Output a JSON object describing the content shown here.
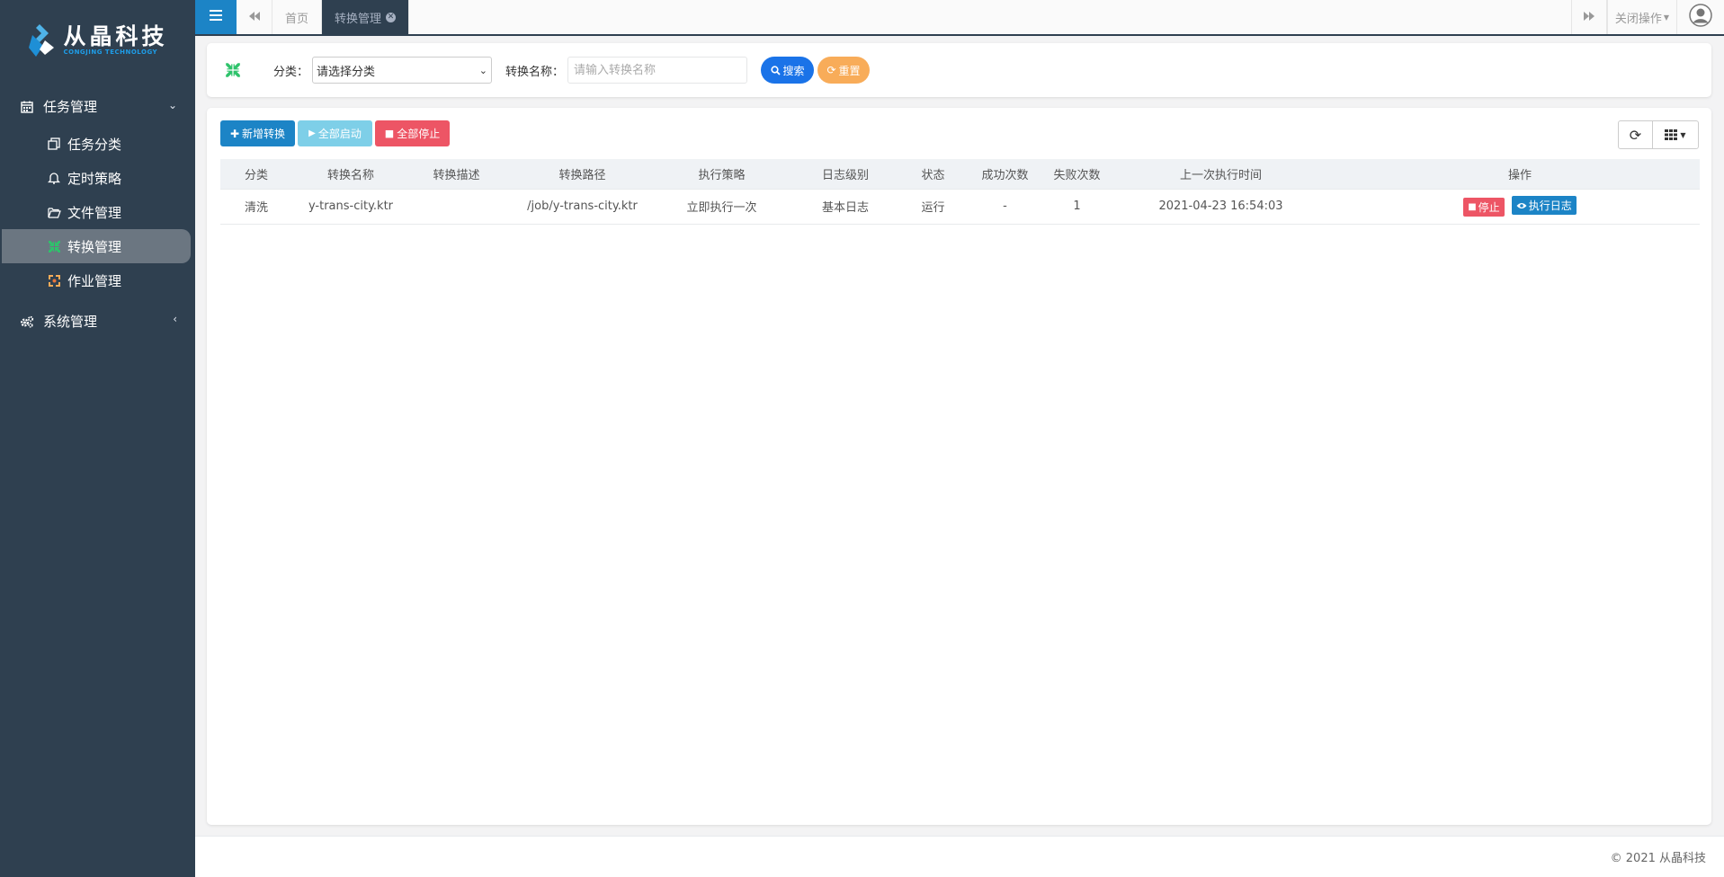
{
  "app": {
    "logo_cn": "从晶科技",
    "logo_en": "CONGJING TECHNOLOGY"
  },
  "sidebar": {
    "groups": [
      {
        "label": "任务管理",
        "icon": "calendar-icon",
        "expanded": true,
        "items": [
          {
            "label": "任务分类",
            "icon": "copy-icon"
          },
          {
            "label": "定时策略",
            "icon": "bell-icon"
          },
          {
            "label": "文件管理",
            "icon": "folder-open-icon"
          },
          {
            "label": "转换管理",
            "icon": "compress-icon",
            "active": true
          },
          {
            "label": "作业管理",
            "icon": "refresh-icon"
          }
        ]
      },
      {
        "label": "系统管理",
        "icon": "gears-icon",
        "expanded": false
      }
    ]
  },
  "topbar": {
    "tabs": [
      {
        "label": "首页"
      },
      {
        "label": "转换管理",
        "active": true
      }
    ],
    "close_ops": "关闭操作"
  },
  "search": {
    "category_label": "分类：",
    "category_value": "请选择分类",
    "name_label": "转换名称：",
    "name_placeholder": "请输入转换名称",
    "search_btn": "搜索",
    "reset_btn": "重置"
  },
  "toolbar": {
    "add": "新增转换",
    "start_all": "全部启动",
    "stop_all": "全部停止"
  },
  "table": {
    "headers": [
      "分类",
      "转换名称",
      "转换描述",
      "转换路径",
      "执行策略",
      "日志级别",
      "状态",
      "成功次数",
      "失败次数",
      "上一次执行时间",
      "操作"
    ],
    "rows": [
      {
        "category": "清洗",
        "name": "y-trans-city.ktr",
        "desc": "",
        "path": "/job/y-trans-city.ktr",
        "strategy": "立即执行一次",
        "log_level": "基本日志",
        "status": "运行",
        "success": "-",
        "fail": "1",
        "last_time": "2021-04-23 16:54:03",
        "stop": "停止",
        "log": "执行日志"
      }
    ]
  },
  "footer": {
    "copyright": "© 2021 从晶科技"
  },
  "colors": {
    "sidebar": "#2f4050",
    "primary": "#1c84c6",
    "info": "#23c6c8",
    "danger": "#ed5565",
    "warning": "#f8ac59",
    "search": "#1a73e8"
  }
}
